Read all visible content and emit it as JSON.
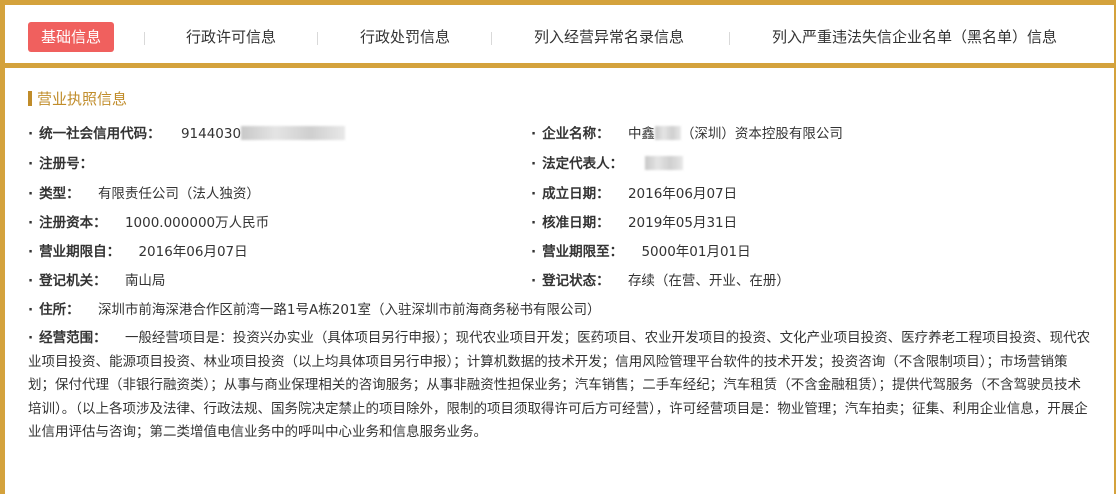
{
  "tabs": [
    {
      "label": "基础信息",
      "active": true
    },
    {
      "label": "行政许可信息",
      "active": false
    },
    {
      "label": "行政处罚信息",
      "active": false
    },
    {
      "label": "列入经营异常名录信息",
      "active": false
    },
    {
      "label": "列入严重违法失信企业名单（黑名单）信息",
      "active": false
    }
  ],
  "section_title": "营业执照信息",
  "bullet": "·",
  "fields": {
    "credit_code": {
      "label": "统一社会信用代码：",
      "value": "9144030"
    },
    "company_name": {
      "label": "企业名称：",
      "value_prefix": "中鑫",
      "value_suffix": "（深圳）资本控股有限公司"
    },
    "reg_no": {
      "label": "注册号：",
      "value": ""
    },
    "legal_rep": {
      "label": "法定代表人：",
      "value": ""
    },
    "type": {
      "label": "类型：",
      "value": "有限责任公司（法人独资）"
    },
    "founded": {
      "label": "成立日期：",
      "value": "2016年06月07日"
    },
    "capital": {
      "label": "注册资本：",
      "value": "1000.000000万人民币"
    },
    "approved": {
      "label": "核准日期：",
      "value": "2019年05月31日"
    },
    "term_from": {
      "label": "营业期限自：",
      "value": "2016年06月07日"
    },
    "term_to": {
      "label": "营业期限至：",
      "value": "5000年01月01日"
    },
    "authority": {
      "label": "登记机关：",
      "value": "南山局"
    },
    "status": {
      "label": "登记状态：",
      "value": "存续（在营、开业、在册）"
    },
    "address": {
      "label": "住所：",
      "value": "深圳市前海深港合作区前湾一路1号A栋201室（入驻深圳市前海商务秘书有限公司）"
    },
    "scope": {
      "label": "经营范围：",
      "value": "一般经营项目是：投资兴办实业（具体项目另行申报）；现代农业项目开发；医药项目、农业开发项目的投资、文化产业项目投资、医疗养老工程项目投资、现代农业项目投资、能源项目投资、林业项目投资（以上均具体项目另行申报）；计算机数据的技术开发；信用风险管理平台软件的技术开发；投资咨询（不含限制项目）；市场营销策划；保付代理（非银行融资类）；从事与商业保理相关的咨询服务；从事非融资性担保业务；汽车销售；二手车经纪；汽车租赁（不含金融租赁）；提供代驾服务（不含驾驶员技术培训）。（以上各项涉及法律、行政法规、国务院决定禁止的项目除外，限制的项目须取得许可后方可经营），许可经营项目是：物业管理；汽车拍卖；征集、利用企业信息，开展企业信用评估与咨询；第二类增值电信业务中的呼叫中心业务和信息服务业务。"
    }
  },
  "colors": {
    "accent": "#d4a23c",
    "active_tab": "#f0605e",
    "section_title": "#c08c2a",
    "text": "#333333"
  }
}
